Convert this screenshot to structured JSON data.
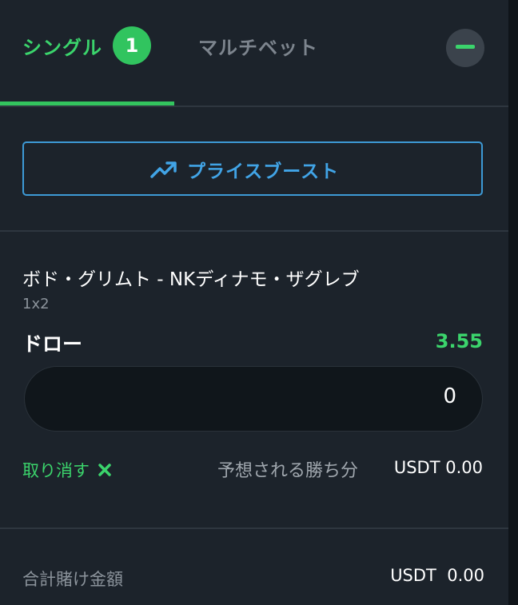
{
  "tabs": {
    "single_label": "シングル",
    "single_count": "1",
    "multi_label": "マルチベット"
  },
  "price_boost": {
    "label": "プライスブースト",
    "icon": "trending-up-icon"
  },
  "bet": {
    "match": "ボド・グリムト - NKディナモ・ザグレブ",
    "market": "1x2",
    "selection": "ドロー",
    "odds": "3.55",
    "stake": "0",
    "cancel_label": "取り消す",
    "potential_win_label": "予想される勝ち分",
    "potential_win_value": "USDT 0.00"
  },
  "summary": {
    "total_stake_label": "合計賭け金額",
    "total_stake_value": "USDT  0.00"
  },
  "colors": {
    "accent_green": "#3bd46c",
    "boost_blue": "#41a4e6",
    "background": "#1c232b"
  }
}
